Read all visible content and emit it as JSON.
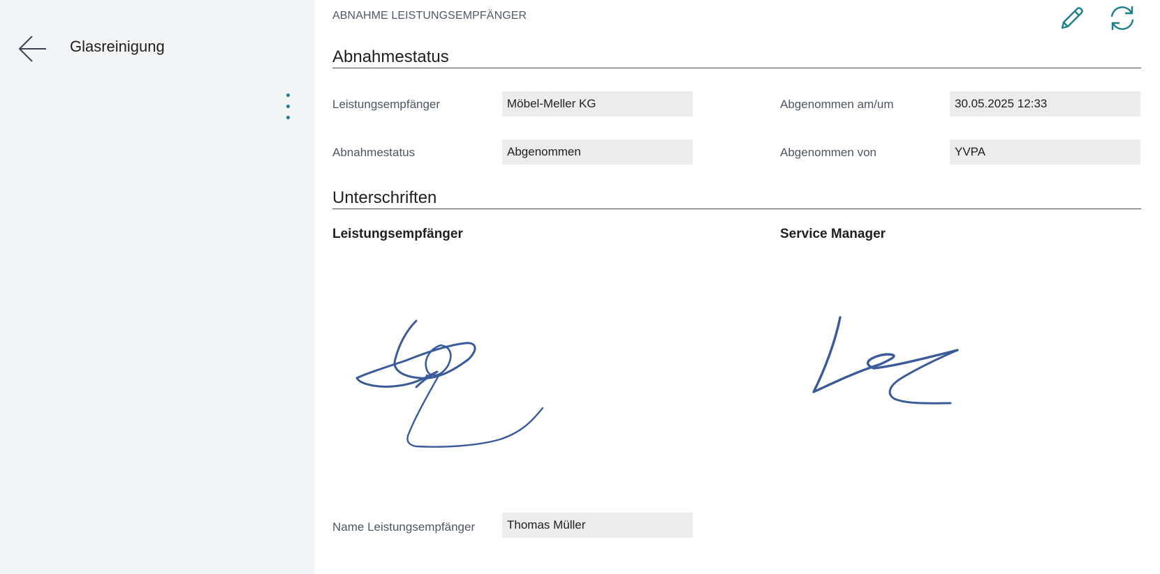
{
  "sidebar": {
    "title": "Glasreinigung",
    "back_icon": "arrow-left-icon",
    "more_icon": "more-vertical-icon"
  },
  "main": {
    "caption": "ABNAHME LEISTUNGSEMPFÄNGER",
    "edit_icon": "pencil-icon",
    "refresh_icon": "refresh-icon",
    "status_section": {
      "heading": "Abnahmestatus",
      "fields": {
        "leistungsempfaenger": {
          "label": "Leistungsempfänger",
          "value": "Möbel-Meller KG"
        },
        "abgenommen_am": {
          "label": "Abgenommen am/um",
          "value": "30.05.2025 12:33"
        },
        "abnahmestatus": {
          "label": "Abnahmestatus",
          "value": "Abgenommen"
        },
        "abgenommen_von": {
          "label": "Abgenommen von",
          "value": "YVPA"
        }
      }
    },
    "signature_section": {
      "heading": "Unterschriften",
      "recipient_heading": "Leistungsempfänger",
      "manager_heading": "Service Manager",
      "recipient_name": {
        "label": "Name Leistungsempfänger",
        "value": "Thomas Müller"
      }
    }
  },
  "colors": {
    "accent": "#1a7f86",
    "signature_ink": "#3a5a9a",
    "panel_bg": "#f3f4f6",
    "field_bg": "#ececed"
  }
}
